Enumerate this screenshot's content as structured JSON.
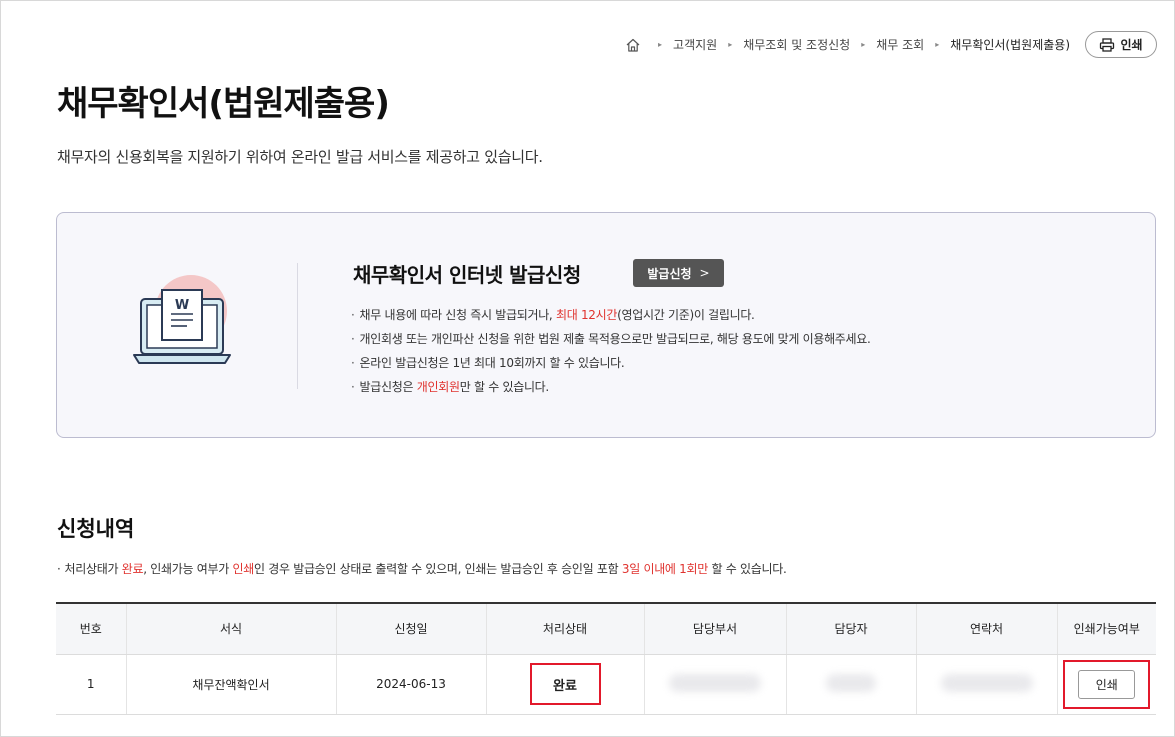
{
  "breadcrumb": {
    "items": [
      "고객지원",
      "채무조회 및 조정신청",
      "채무 조회",
      "채무확인서(법원제출용)"
    ],
    "print_label": "인쇄"
  },
  "page": {
    "title": "채무확인서(법원제출용)",
    "description": "채무자의 신용회복을 지원하기 위하여 온라인 발급 서비스를 제공하고 있습니다."
  },
  "info": {
    "title": "채무확인서 인터넷 발급신청",
    "apply_label": "발급신청",
    "bullets": [
      {
        "before": "채무 내용에 따라 신청 즉시 발급되거나, ",
        "highlight": "최대 12시간",
        "after": "(영업시간 기준)이 걸립니다."
      },
      {
        "before": "개인회생 또는 개인파산 신청을 위한 법원 제출 목적용으로만 발급되므로, 해당 용도에 맞게 이용해주세요.",
        "highlight": "",
        "after": ""
      },
      {
        "before": "온라인 발급신청은 1년 최대 10회까지 할 수 있습니다.",
        "highlight": "",
        "after": ""
      },
      {
        "before": "발급신청은 ",
        "highlight": "개인회원",
        "after": "만 할 수 있습니다."
      }
    ],
    "illustration_letter": "W"
  },
  "history": {
    "title": "신청내역",
    "notice": {
      "p1": "처리상태가 ",
      "h1": "완료",
      "p2": ", 인쇄가능 여부가 ",
      "h2": "인쇄",
      "p3": "인 경우 발급승인 상태로 출력할 수 있으며, 인쇄는 발급승인 후 승인일 포함 ",
      "h3": "3일 이내에 1회만",
      "p4": " 할 수 있습니다."
    },
    "columns": [
      "번호",
      "서식",
      "신청일",
      "처리상태",
      "담당부서",
      "담당자",
      "연락처",
      "인쇄가능여부"
    ],
    "rows": [
      {
        "no": "1",
        "form": "채무잔액확인서",
        "date": "2024-06-13",
        "status": "완료",
        "print_label": "인쇄"
      }
    ]
  },
  "colors": {
    "accent_red": "#e0332f",
    "highlight_box": "#e2192b",
    "button_dark": "#555555"
  },
  "icons": [
    "home-icon",
    "printer-icon",
    "laptop-document-icon",
    "chevron-right-icon"
  ]
}
